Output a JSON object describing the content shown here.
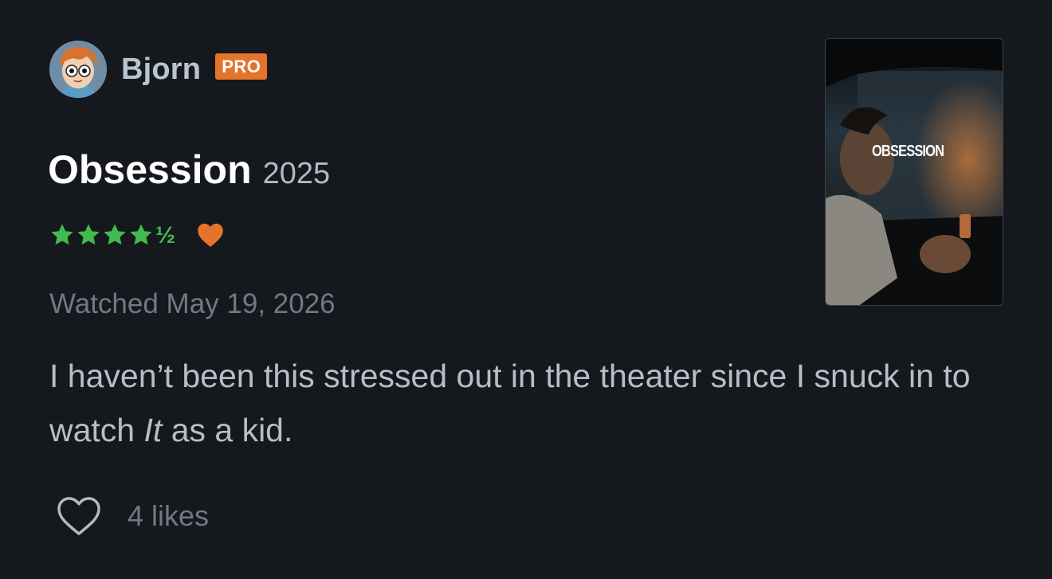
{
  "author": {
    "name": "Bjorn",
    "badge": "PRO",
    "avatar_icon": "avatar-cartoon-boy"
  },
  "film": {
    "title": "Obsession",
    "year": "2025",
    "poster_title": "OBSESSION"
  },
  "rating": {
    "stars": 4.5,
    "full_stars": 4,
    "half_symbol": "½",
    "liked": true,
    "star_color": "#40bc4f",
    "heart_color": "#e4742b"
  },
  "watched": "Watched May 19, 2026",
  "review": {
    "text_before": "I haven’t been this stressed out in the theater since I snuck in to watch ",
    "text_italic": "It",
    "text_after": " as a kid."
  },
  "likes": {
    "count_label": "4 likes",
    "icon": "heart-outline-icon"
  },
  "colors": {
    "background": "#15181d",
    "pro_badge": "#e4742b"
  }
}
